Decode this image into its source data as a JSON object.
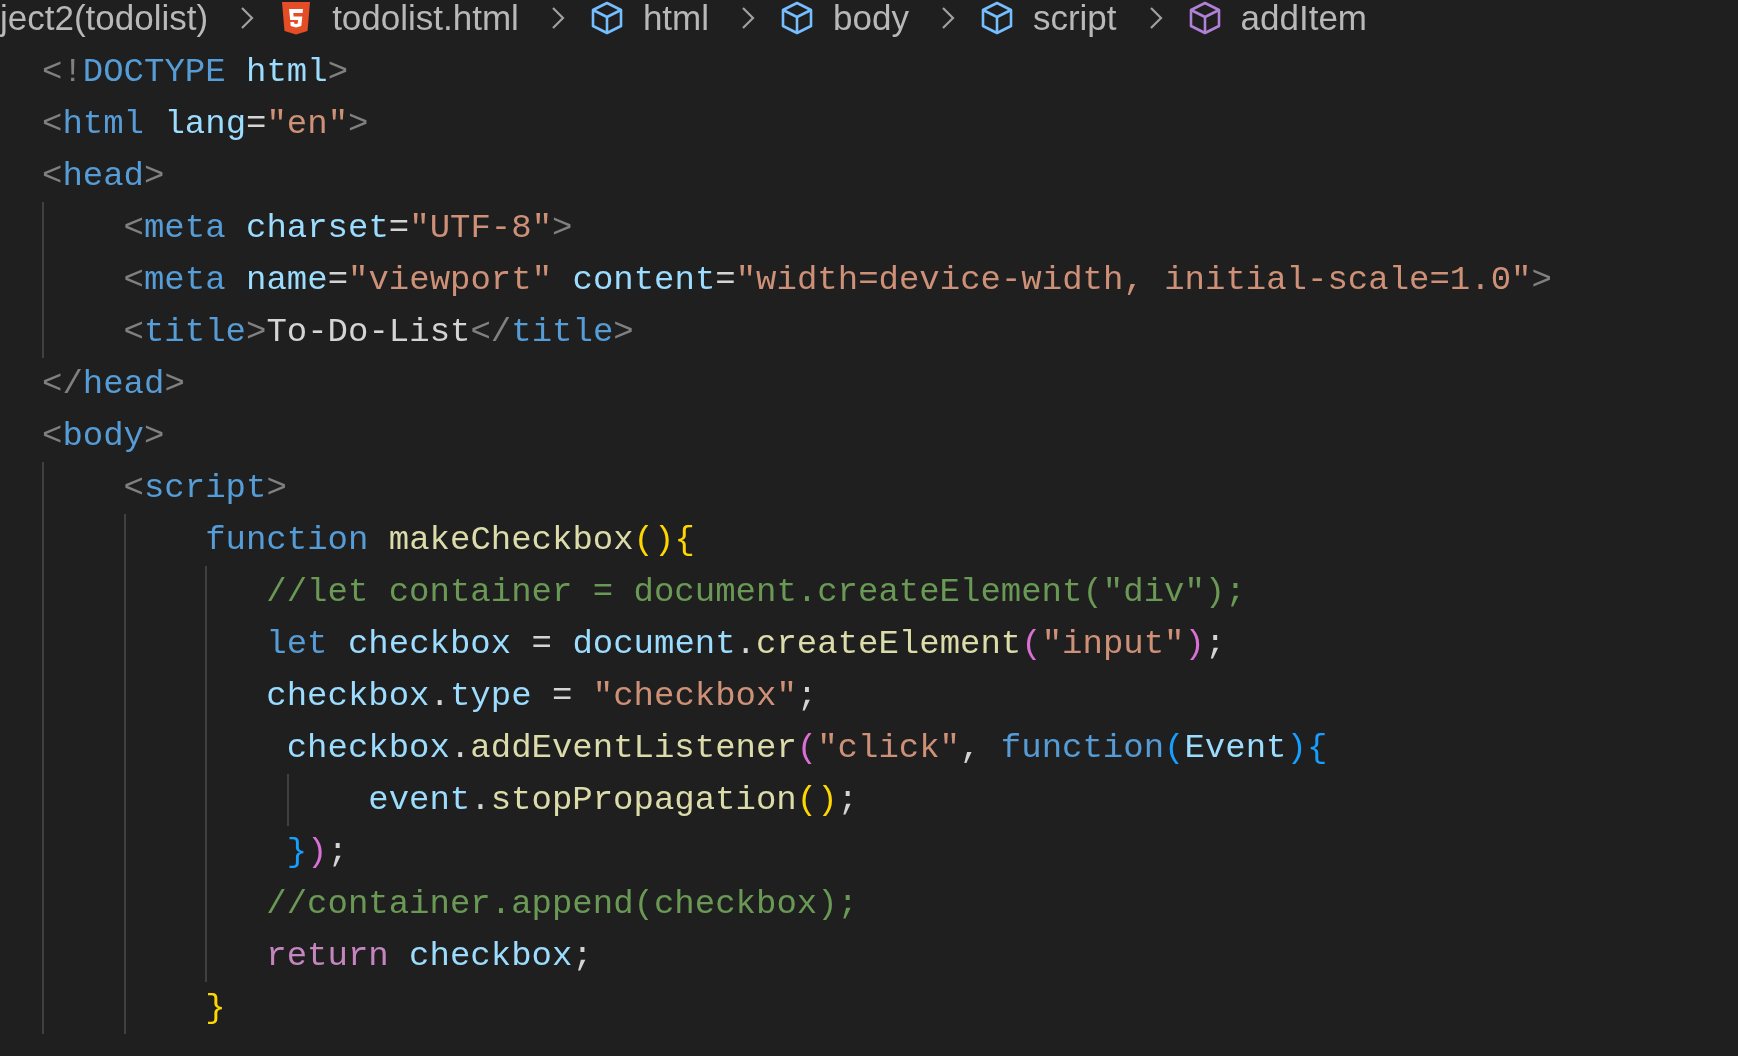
{
  "breadcrumb": [
    {
      "label": "ject2(todolist)",
      "kind": "folder"
    },
    {
      "label": "todolist.html",
      "kind": "file"
    },
    {
      "label": "html",
      "kind": "element"
    },
    {
      "label": "body",
      "kind": "element"
    },
    {
      "label": "script",
      "kind": "element"
    },
    {
      "label": "addItem",
      "kind": "function"
    }
  ],
  "code_lines": [
    {
      "tokens": [
        {
          "kind": "punct",
          "t": "<!"
        },
        {
          "kind": "tag",
          "t": "DOCTYPE"
        },
        {
          "kind": "attr",
          "t": " html"
        },
        {
          "kind": "punct",
          "t": ">"
        }
      ]
    },
    {
      "tokens": [
        {
          "kind": "punct",
          "t": "<"
        },
        {
          "kind": "tag",
          "t": "html"
        },
        {
          "kind": "attr",
          "t": " lang"
        },
        {
          "kind": "text",
          "t": "="
        },
        {
          "kind": "str",
          "t": "\"en\""
        },
        {
          "kind": "punct",
          "t": ">"
        }
      ]
    },
    {
      "tokens": [
        {
          "kind": "punct",
          "t": "<"
        },
        {
          "kind": "tag",
          "t": "head"
        },
        {
          "kind": "punct",
          "t": ">"
        }
      ],
      "children": [
        {
          "tokens": [
            {
              "kind": "punct",
              "t": "    <"
            },
            {
              "kind": "tag",
              "t": "meta"
            },
            {
              "kind": "attr",
              "t": " charset"
            },
            {
              "kind": "text",
              "t": "="
            },
            {
              "kind": "str",
              "t": "\"UTF-8\""
            },
            {
              "kind": "punct",
              "t": ">"
            }
          ]
        },
        {
          "tokens": [
            {
              "kind": "punct",
              "t": "    <"
            },
            {
              "kind": "tag",
              "t": "meta"
            },
            {
              "kind": "attr",
              "t": " name"
            },
            {
              "kind": "text",
              "t": "="
            },
            {
              "kind": "str",
              "t": "\"viewport\""
            },
            {
              "kind": "attr",
              "t": " content"
            },
            {
              "kind": "text",
              "t": "="
            },
            {
              "kind": "str",
              "t": "\"width=device-width, initial-scale=1.0\""
            },
            {
              "kind": "punct",
              "t": ">"
            }
          ]
        },
        {
          "tokens": [
            {
              "kind": "punct",
              "t": "    <"
            },
            {
              "kind": "tag",
              "t": "title"
            },
            {
              "kind": "punct",
              "t": ">"
            },
            {
              "kind": "text",
              "t": "To-Do-List"
            },
            {
              "kind": "punct",
              "t": "</"
            },
            {
              "kind": "tag",
              "t": "title"
            },
            {
              "kind": "punct",
              "t": ">"
            }
          ]
        }
      ]
    },
    {
      "tokens": [
        {
          "kind": "punct",
          "t": "</"
        },
        {
          "kind": "tag",
          "t": "head"
        },
        {
          "kind": "punct",
          "t": ">"
        }
      ]
    },
    {
      "tokens": [
        {
          "kind": "punct",
          "t": "<"
        },
        {
          "kind": "tag",
          "t": "body"
        },
        {
          "kind": "punct",
          "t": ">"
        }
      ],
      "children": [
        {
          "tokens": [
            {
              "kind": "punct",
              "t": "    <"
            },
            {
              "kind": "tag",
              "t": "script"
            },
            {
              "kind": "punct",
              "t": ">"
            }
          ],
          "children": [
            {
              "tokens": [
                {
                  "kind": "kw",
                  "t": "        function"
                },
                {
                  "kind": "fn",
                  "t": " makeCheckbox"
                },
                {
                  "kind": "b1",
                  "t": "(){"
                }
              ],
              "children": [
                {
                  "tokens": [
                    {
                      "kind": "comment",
                      "t": "           //let container = document.createElement(\"div\");"
                    }
                  ]
                },
                {
                  "tokens": [
                    {
                      "kind": "kw",
                      "t": "           let"
                    },
                    {
                      "kind": "var",
                      "t": " checkbox"
                    },
                    {
                      "kind": "text",
                      "t": " = "
                    },
                    {
                      "kind": "var",
                      "t": "document"
                    },
                    {
                      "kind": "text",
                      "t": "."
                    },
                    {
                      "kind": "fn",
                      "t": "createElement"
                    },
                    {
                      "kind": "b2",
                      "t": "("
                    },
                    {
                      "kind": "str",
                      "t": "\"input\""
                    },
                    {
                      "kind": "b2",
                      "t": ")"
                    },
                    {
                      "kind": "text",
                      "t": ";"
                    }
                  ]
                },
                {
                  "tokens": [
                    {
                      "kind": "var",
                      "t": "           checkbox"
                    },
                    {
                      "kind": "text",
                      "t": "."
                    },
                    {
                      "kind": "var",
                      "t": "type"
                    },
                    {
                      "kind": "text",
                      "t": " = "
                    },
                    {
                      "kind": "str",
                      "t": "\"checkbox\""
                    },
                    {
                      "kind": "text",
                      "t": ";"
                    }
                  ]
                },
                {
                  "tokens": [
                    {
                      "kind": "var",
                      "t": "            checkbox"
                    },
                    {
                      "kind": "text",
                      "t": "."
                    },
                    {
                      "kind": "fn",
                      "t": "addEventListener"
                    },
                    {
                      "kind": "b2",
                      "t": "("
                    },
                    {
                      "kind": "str",
                      "t": "\"click\""
                    },
                    {
                      "kind": "text",
                      "t": ","
                    },
                    {
                      "kind": "kw",
                      "t": " function"
                    },
                    {
                      "kind": "b3",
                      "t": "("
                    },
                    {
                      "kind": "var",
                      "t": "Event"
                    },
                    {
                      "kind": "b3",
                      "t": "){"
                    }
                  ],
                  "children": [
                    {
                      "tokens": [
                        {
                          "kind": "var",
                          "t": "                event"
                        },
                        {
                          "kind": "text",
                          "t": "."
                        },
                        {
                          "kind": "fn",
                          "t": "stopPropagation"
                        },
                        {
                          "kind": "b1",
                          "t": "()"
                        },
                        {
                          "kind": "text",
                          "t": ";"
                        }
                      ]
                    }
                  ]
                },
                {
                  "tokens": [
                    {
                      "kind": "b3",
                      "t": "            }"
                    },
                    {
                      "kind": "b2",
                      "t": ")"
                    },
                    {
                      "kind": "text",
                      "t": ";"
                    }
                  ]
                },
                {
                  "tokens": [
                    {
                      "kind": "comment",
                      "t": "           //container.append(checkbox);"
                    }
                  ]
                },
                {
                  "tokens": [
                    {
                      "kind": "ctrl",
                      "t": "           return"
                    },
                    {
                      "kind": "var",
                      "t": " checkbox"
                    },
                    {
                      "kind": "text",
                      "t": ";"
                    }
                  ]
                }
              ]
            },
            {
              "tokens": [
                {
                  "kind": "b1",
                  "t": "        }"
                }
              ]
            }
          ]
        }
      ]
    }
  ]
}
